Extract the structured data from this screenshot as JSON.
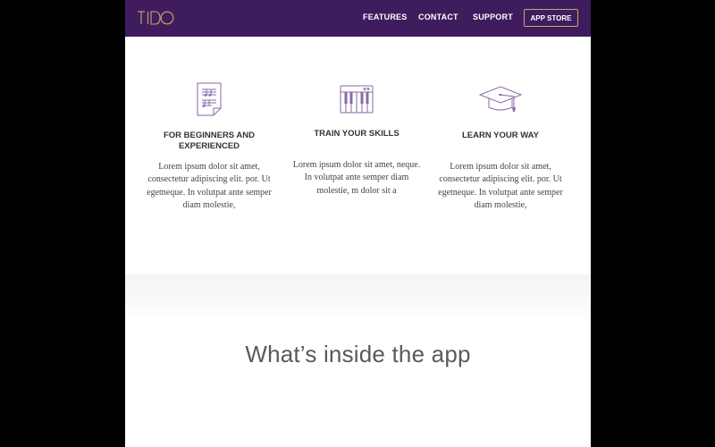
{
  "nav": {
    "logo_text": "TIDO",
    "links": [
      "FEATURES",
      "CONTACT",
      "SUPPORT"
    ],
    "cta_label": "APP STORE"
  },
  "features": [
    {
      "icon": "sheet-music-icon",
      "title": "FOR BEGINNERS AND EXPERIENCED",
      "body": "Lorem ipsum dolor sit amet, consectetur adipiscing elit. por. Ut egetneque. In volutpat ante semper diam molestie,"
    },
    {
      "icon": "piano-keyboard-icon",
      "title": "TRAIN YOUR SKILLS",
      "body": "Lorem ipsum dolor sit amet, neque. In volutpat ante semper diam molestie, m dolor sit a"
    },
    {
      "icon": "graduation-cap-icon",
      "title": "LEARN YOUR WAY",
      "body": "Lorem ipsum dolor sit amet, consectetur adipiscing elit. por. Ut egetneque. In volutpat ante semper diam molestie,"
    }
  ],
  "section": {
    "heading": "What’s inside the app"
  },
  "colors": {
    "nav_background": "#3f1c5d",
    "accent_gold": "#c9a86a",
    "icon_purple": "#8a6aa3"
  }
}
